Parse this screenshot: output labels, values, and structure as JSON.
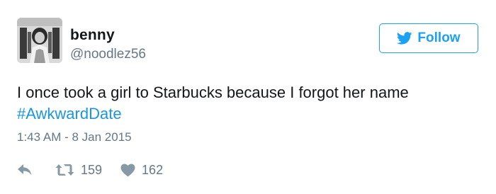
{
  "author": {
    "name": "benny",
    "handle": "@noodlez56"
  },
  "follow_button": {
    "label": "Follow",
    "icon": "twitter-bird-icon",
    "color": "#1da1f2"
  },
  "tweet": {
    "text": "I once took a girl to Starbucks because I forgot her name",
    "hashtag": "#AwkwardDate",
    "timestamp": "1:43 AM - 8 Jan 2015"
  },
  "actions": {
    "reply_icon": "reply-icon",
    "retweet_icon": "retweet-icon",
    "retweet_count": "159",
    "like_icon": "heart-icon",
    "like_count": "162"
  },
  "colors": {
    "link": "#1b95e0",
    "text": "#14171a",
    "muted": "#657786",
    "icon": "#8899a6"
  }
}
